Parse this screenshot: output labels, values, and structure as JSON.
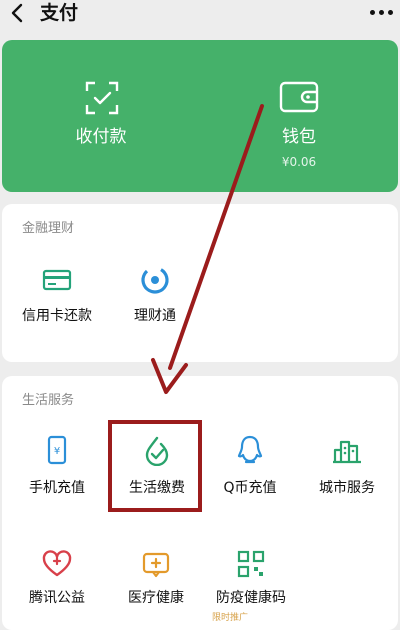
{
  "nav": {
    "title": "支付"
  },
  "wallet_card": {
    "collect": {
      "label": "收付款"
    },
    "wallet": {
      "label": "钱包",
      "balance": "¥0.06"
    }
  },
  "finance": {
    "title": "金融理财",
    "items": [
      {
        "label": "信用卡还款",
        "icon": "credit-card-icon"
      },
      {
        "label": "理财通",
        "icon": "wealth-icon"
      }
    ]
  },
  "life": {
    "title": "生活服务",
    "items": [
      {
        "label": "手机充值",
        "icon": "phone-icon"
      },
      {
        "label": "生活缴费",
        "icon": "utility-bill-icon"
      },
      {
        "label": "Q币充值",
        "icon": "qq-penguin-icon"
      },
      {
        "label": "城市服务",
        "icon": "city-icon"
      },
      {
        "label": "腾讯公益",
        "icon": "heart-icon"
      },
      {
        "label": "医疗健康",
        "icon": "medical-icon"
      },
      {
        "label": "防疫健康码",
        "icon": "qr-code-icon"
      }
    ],
    "note": "限时推广"
  },
  "colors": {
    "green": "#45b16a",
    "annotation": "#9b1c1c"
  }
}
